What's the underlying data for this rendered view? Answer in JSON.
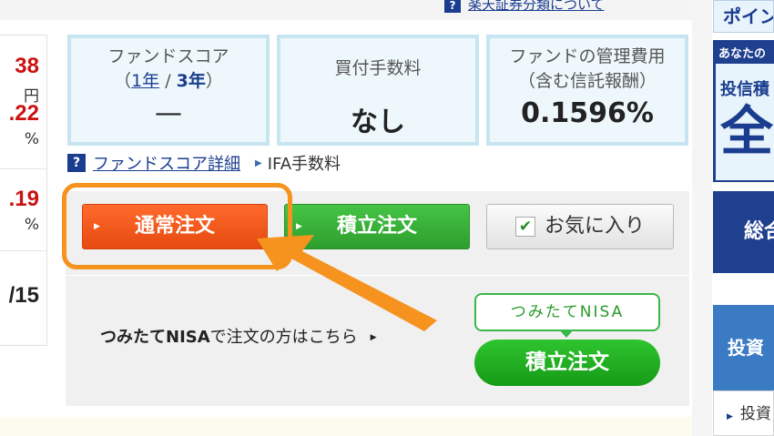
{
  "top_link": {
    "text": "楽天証券分類について"
  },
  "left_panel": {
    "v1": "38",
    "v1_unit": "円",
    "v2": ".22",
    "v2_unit": "%",
    "v3": ".19",
    "v3_unit": "%",
    "v4": "/15"
  },
  "score_boxes": [
    {
      "title_line1": "ファンドスコア",
      "open": "（",
      "link_1y": "1年",
      "sep": " / ",
      "bold_3y": "3年",
      "close": "）",
      "value": "—"
    },
    {
      "title": "買付手数料",
      "value": "なし"
    },
    {
      "title_line1": "ファンドの管理費用",
      "title_line2": "（含む信託報酬）",
      "value": "0.1596%"
    }
  ],
  "detail_links": {
    "help_icon": "?",
    "score_detail": "ファンドスコア詳細",
    "ifa_fee": "IFA手数料"
  },
  "order_buttons": {
    "normal": "通常注文",
    "tsumitate": "積立注文",
    "favorite": "お気に入り"
  },
  "nisa": {
    "text_bold": "つみたてNISA",
    "text_rest": "で注文の方はこちら",
    "bubble": "つみたてNISA",
    "button": "積立注文"
  },
  "sidebar": {
    "b1": "ポイン",
    "b2_top": "あなたの",
    "b2_mid": "投信積",
    "b2_big": "全",
    "b3": "総合",
    "b4": "投資",
    "b5": "投資"
  },
  "colors": {
    "highlight_orange": "#f5931e",
    "normal_order": "#f05a1e",
    "tsumitate_green": "#3cb83c",
    "link_blue": "#1a3d8f",
    "box_border": "#c6e5f1"
  },
  "icons": [
    "help-icon",
    "triangle-right-icon",
    "checkbox-check-icon",
    "arrow-annotation-icon"
  ]
}
